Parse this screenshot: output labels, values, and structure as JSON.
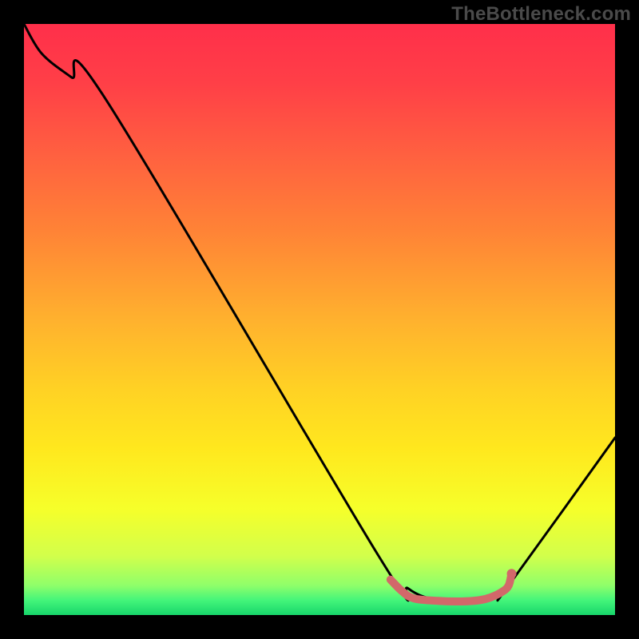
{
  "watermark": "TheBottleneck.com",
  "gradient_stops": [
    {
      "offset": 0.0,
      "color": "#ff2f4a"
    },
    {
      "offset": 0.1,
      "color": "#ff3f47"
    },
    {
      "offset": 0.22,
      "color": "#ff6040"
    },
    {
      "offset": 0.35,
      "color": "#ff8336"
    },
    {
      "offset": 0.5,
      "color": "#ffb12e"
    },
    {
      "offset": 0.62,
      "color": "#ffd224"
    },
    {
      "offset": 0.72,
      "color": "#ffe81e"
    },
    {
      "offset": 0.82,
      "color": "#f6ff2a"
    },
    {
      "offset": 0.9,
      "color": "#d2ff4b"
    },
    {
      "offset": 0.95,
      "color": "#8fff6a"
    },
    {
      "offset": 0.975,
      "color": "#44f57a"
    },
    {
      "offset": 1.0,
      "color": "#17d66b"
    }
  ],
  "chart_data": {
    "type": "line",
    "title": "",
    "xlabel": "",
    "ylabel": "",
    "xlim": [
      0,
      100
    ],
    "ylim": [
      0,
      100
    ],
    "annotations": [
      "TheBottleneck.com"
    ],
    "series": [
      {
        "name": "bottleneck-curve",
        "x": [
          0.0,
          3.0,
          8.0,
          14.0,
          60.0,
          65.0,
          70.0,
          76.0,
          80.0,
          82.0,
          100.0
        ],
        "y": [
          100.0,
          95.0,
          91.0,
          87.0,
          10.0,
          4.5,
          2.5,
          2.3,
          3.0,
          5.0,
          30.0
        ]
      },
      {
        "name": "highlight-valley",
        "style": "thick-red",
        "x": [
          62.0,
          64.0,
          66.0,
          70.0,
          74.0,
          77.0,
          79.0,
          81.0,
          82.0,
          82.5
        ],
        "y": [
          6.0,
          4.0,
          2.8,
          2.4,
          2.3,
          2.5,
          3.0,
          4.0,
          5.0,
          7.0
        ]
      }
    ],
    "highlight_color": "#d2686a",
    "curve_color": "#000000"
  }
}
